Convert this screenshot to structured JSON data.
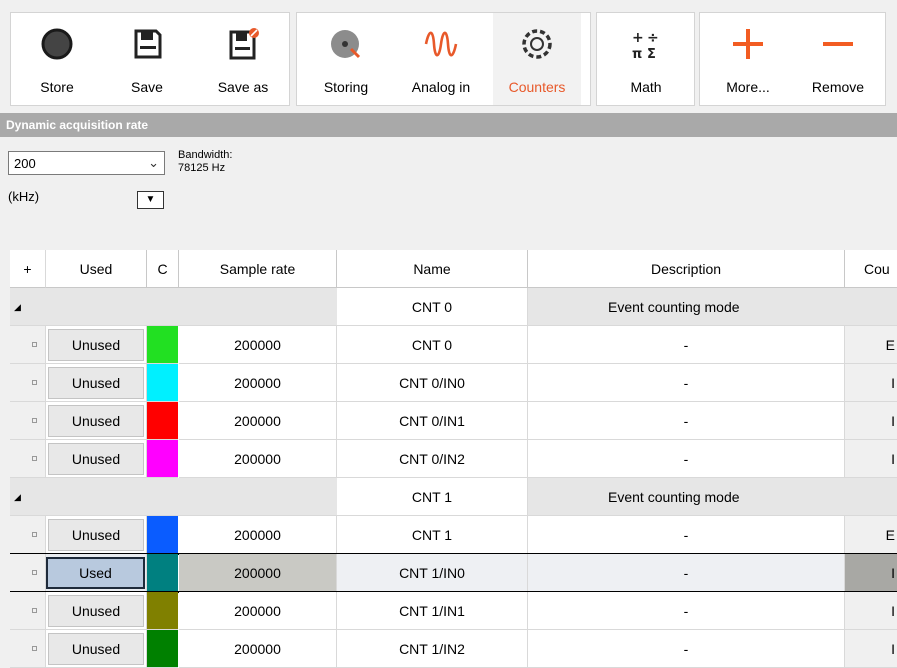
{
  "ribbon": {
    "groups": [
      {
        "id": "file",
        "buttons": [
          {
            "label": "Store",
            "icon": "record-circle-icon"
          },
          {
            "label": "Save",
            "icon": "floppy-disk-icon"
          },
          {
            "label": "Save as",
            "icon": "floppy-disk-edit-icon"
          }
        ]
      },
      {
        "id": "channels",
        "buttons": [
          {
            "label": "Storing",
            "icon": "storing-disc-icon"
          },
          {
            "label": "Analog in",
            "icon": "analog-wave-icon"
          },
          {
            "label": "Counters",
            "icon": "counter-gear-icon",
            "active": true
          }
        ]
      },
      {
        "id": "math",
        "buttons": [
          {
            "label": "Math",
            "icon": "math-symbols-icon"
          }
        ]
      },
      {
        "id": "manage",
        "buttons": [
          {
            "label": "More...",
            "icon": "plus-icon"
          },
          {
            "label": "Remove",
            "icon": "minus-icon"
          }
        ]
      }
    ]
  },
  "acquisition": {
    "title": "Dynamic acquisition rate",
    "rate_value": "200",
    "unit": "(kHz)",
    "bandwidth_label": "Bandwidth:",
    "bandwidth_value": "78125 Hz"
  },
  "grid": {
    "columns": [
      "+",
      "Used",
      "C",
      "Sample rate",
      "Name",
      "Description",
      "Cou"
    ],
    "groups": [
      {
        "name": "CNT 0",
        "description": "Event counting mode",
        "rows": [
          {
            "used": "Unused",
            "color": "#22e022",
            "sample_rate": "200000",
            "name": "CNT 0",
            "description": "-",
            "counter": "E"
          },
          {
            "used": "Unused",
            "color": "#00f0ff",
            "sample_rate": "200000",
            "name": "CNT 0/IN0",
            "description": "-",
            "counter": "I"
          },
          {
            "used": "Unused",
            "color": "#ff0000",
            "sample_rate": "200000",
            "name": "CNT 0/IN1",
            "description": "-",
            "counter": "I"
          },
          {
            "used": "Unused",
            "color": "#ff00ff",
            "sample_rate": "200000",
            "name": "CNT 0/IN2",
            "description": "-",
            "counter": "I"
          }
        ]
      },
      {
        "name": "CNT 1",
        "description": "Event counting mode",
        "rows": [
          {
            "used": "Unused",
            "color": "#0a5cff",
            "sample_rate": "200000",
            "name": "CNT 1",
            "description": "-",
            "counter": "E"
          },
          {
            "used": "Used",
            "color": "#008080",
            "sample_rate": "200000",
            "name": "CNT 1/IN0",
            "description": "-",
            "counter": "I",
            "selected": true
          },
          {
            "used": "Unused",
            "color": "#808000",
            "sample_rate": "200000",
            "name": "CNT 1/IN1",
            "description": "-",
            "counter": "I"
          },
          {
            "used": "Unused",
            "color": "#008000",
            "sample_rate": "200000",
            "name": "CNT 1/IN2",
            "description": "-",
            "counter": "I"
          }
        ]
      }
    ]
  },
  "colors": {
    "accent": "#e8592a",
    "panel_header": "#a9a9a9"
  }
}
